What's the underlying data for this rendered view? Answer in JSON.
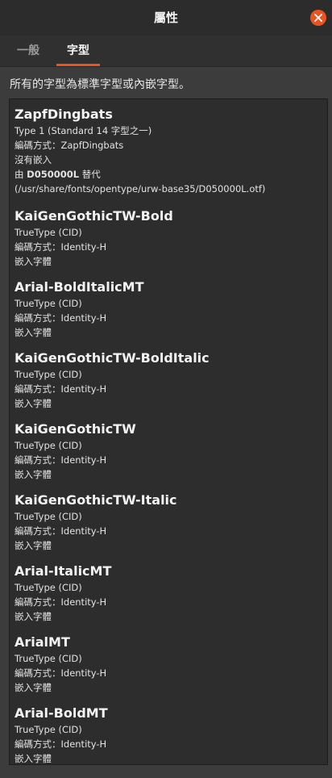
{
  "window": {
    "title": "屬性"
  },
  "tabs": [
    {
      "label": "一般",
      "active": false
    },
    {
      "label": "字型",
      "active": true
    }
  ],
  "summary": "所有的字型為標準字型或內嵌字型。",
  "colors": {
    "accent": "#e95420",
    "background": "#3c3c3c",
    "list_background": "#2d2d2d"
  },
  "fonts": [
    {
      "name": "ZapfDingbats",
      "type": "Type 1 (Standard 14 字型之一)",
      "encoding": "編碼方式：ZapfDingbats",
      "embedded": "沒有嵌入",
      "substitute_prefix": "由",
      "substitute_name": "D050000L",
      "substitute_suffix": "替代",
      "substitute_path": "(/usr/share/fonts/opentype/urw-base35/D050000L.otf)"
    },
    {
      "name": "KaiGenGothicTW-Bold",
      "type": "TrueType (CID)",
      "encoding": "編碼方式：Identity-H",
      "embedded": "嵌入字體"
    },
    {
      "name": "Arial-BoldItalicMT",
      "type": "TrueType (CID)",
      "encoding": "編碼方式：Identity-H",
      "embedded": "嵌入字體"
    },
    {
      "name": "KaiGenGothicTW-BoldItalic",
      "type": "TrueType (CID)",
      "encoding": "編碼方式：Identity-H",
      "embedded": "嵌入字體"
    },
    {
      "name": "KaiGenGothicTW",
      "type": "TrueType (CID)",
      "encoding": "編碼方式：Identity-H",
      "embedded": "嵌入字體"
    },
    {
      "name": "KaiGenGothicTW-Italic",
      "type": "TrueType (CID)",
      "encoding": "編碼方式：Identity-H",
      "embedded": "嵌入字體"
    },
    {
      "name": "Arial-ItalicMT",
      "type": "TrueType (CID)",
      "encoding": "編碼方式：Identity-H",
      "embedded": "嵌入字體"
    },
    {
      "name": "ArialMT",
      "type": "TrueType (CID)",
      "encoding": "編碼方式：Identity-H",
      "embedded": "嵌入字體"
    },
    {
      "name": "Arial-BoldMT",
      "type": "TrueType (CID)",
      "encoding": "編碼方式：Identity-H",
      "embedded": "嵌入字體"
    }
  ]
}
